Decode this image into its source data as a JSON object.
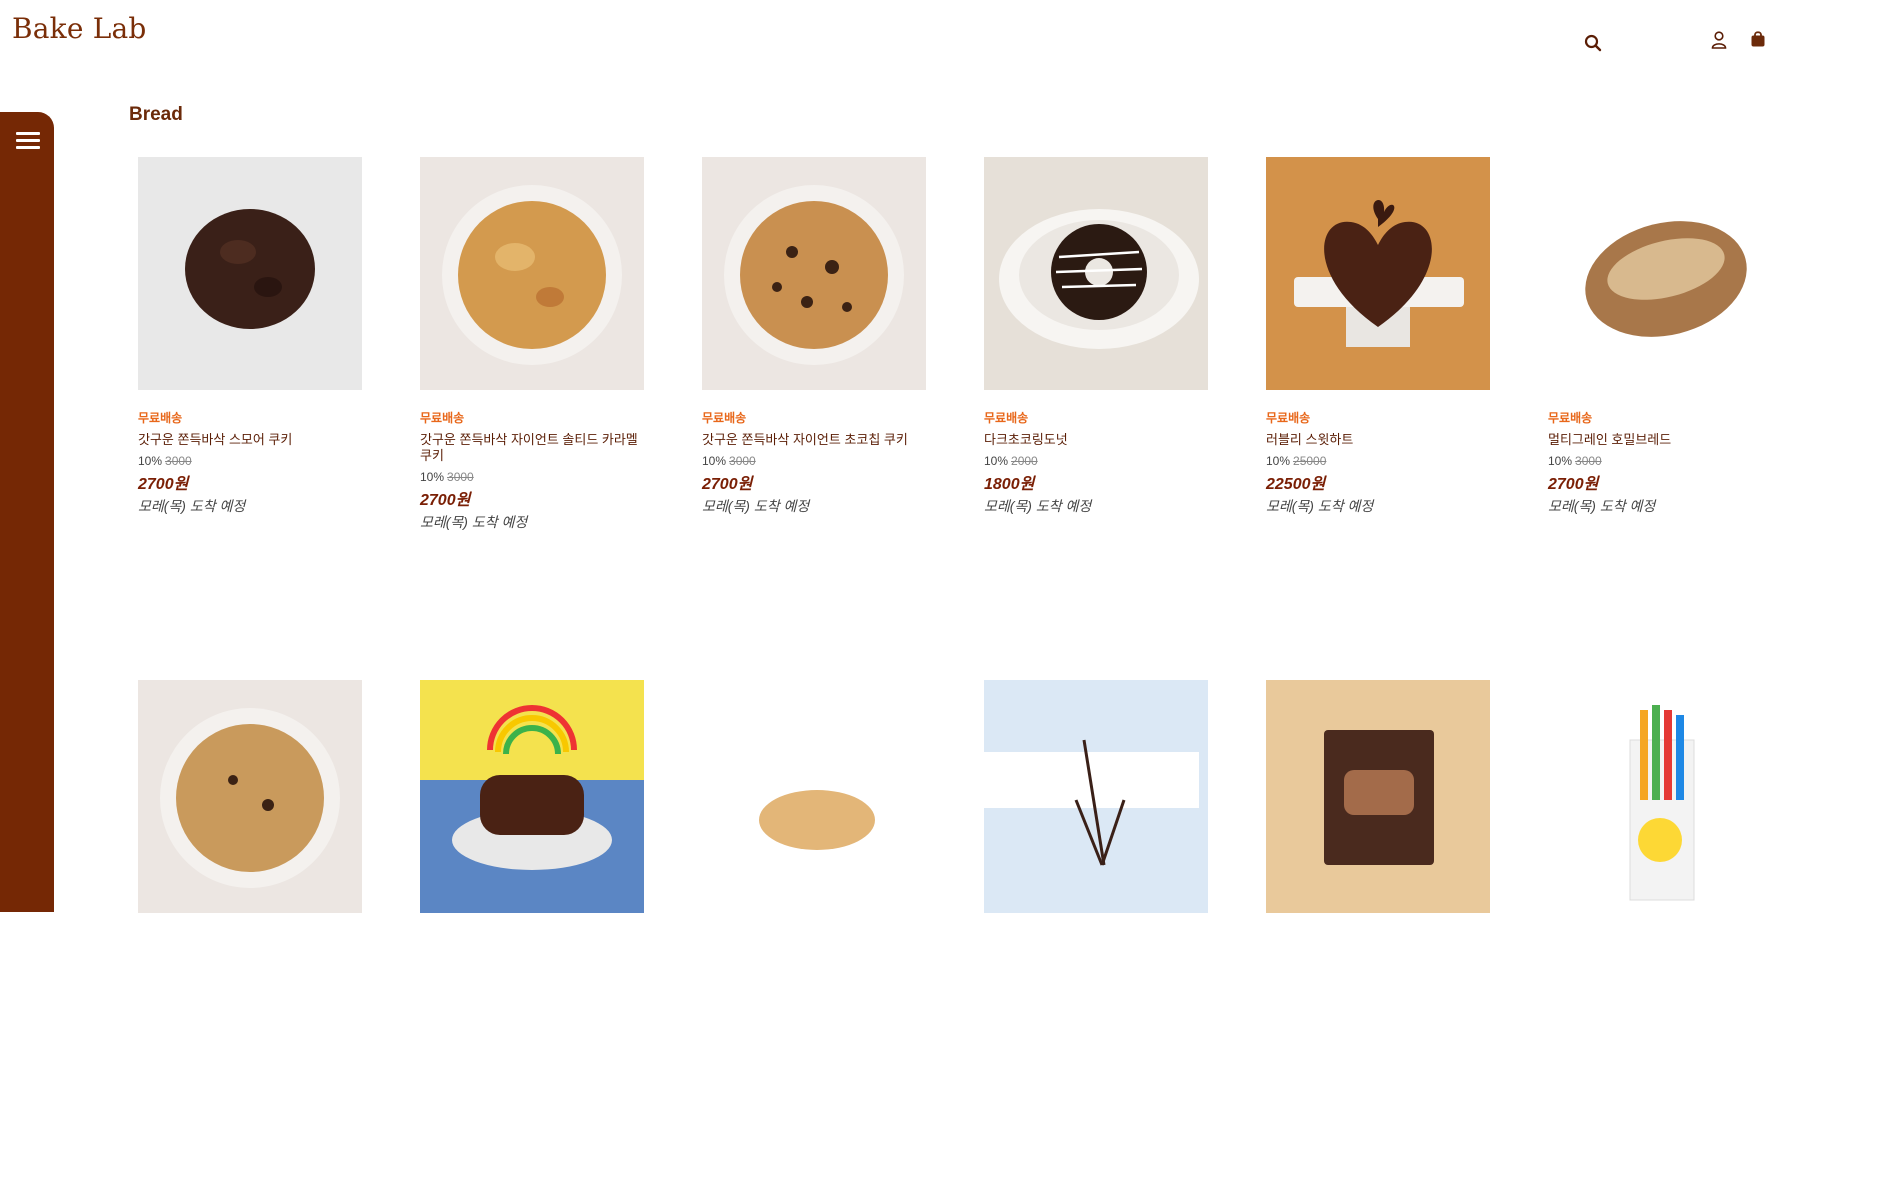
{
  "header": {
    "logo": "Bake Lab",
    "icons": {
      "search": "search-icon",
      "user": "user-icon",
      "cart": "shopping-bag-icon"
    }
  },
  "sidebar": {
    "menu_icon": "hamburger-menu-icon"
  },
  "section": {
    "title": "Bread"
  },
  "colors": {
    "brand": "#752805",
    "accent": "#e8671a",
    "price": "#7a1f05"
  },
  "products": [
    {
      "badge": "무료배송",
      "name": "갓구운 쫀득바삭 스모어 쿠키",
      "discount": "10%",
      "original": "3000",
      "price": "2700원",
      "delivery": "모레(목) 도착 예정"
    },
    {
      "badge": "무료배송",
      "name": "갓구운 쫀득바삭 자이언트 솔티드 카라멜 쿠키",
      "discount": "10%",
      "original": "3000",
      "price": "2700원",
      "delivery": "모레(목) 도착 예정"
    },
    {
      "badge": "무료배송",
      "name": "갓구운 쫀득바삭 자이언트 초코칩 쿠키",
      "discount": "10%",
      "original": "3000",
      "price": "2700원",
      "delivery": "모레(목) 도착 예정"
    },
    {
      "badge": "무료배송",
      "name": "다크초코링도넛",
      "discount": "10%",
      "original": "2000",
      "price": "1800원",
      "delivery": "모레(목) 도착 예정"
    },
    {
      "badge": "무료배송",
      "name": "러블리 스윗하트",
      "discount": "10%",
      "original": "25000",
      "price": "22500원",
      "delivery": "모레(목) 도착 예정"
    },
    {
      "badge": "무료배송",
      "name": "멀티그레인 호밀브레드",
      "discount": "10%",
      "original": "3000",
      "price": "2700원",
      "delivery": "모레(목) 도착 예정"
    }
  ]
}
